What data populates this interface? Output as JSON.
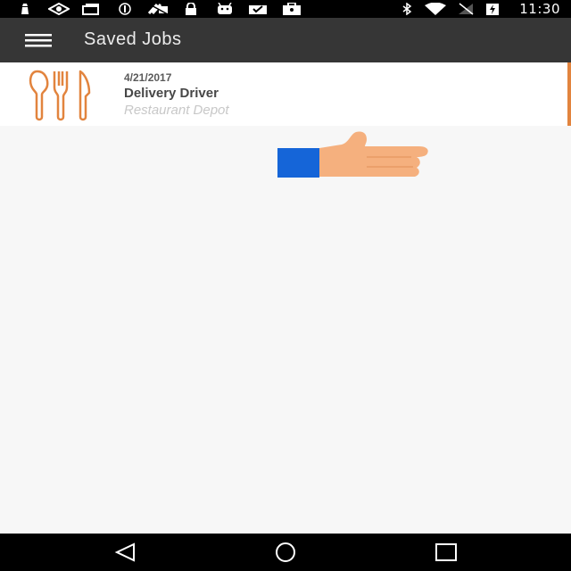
{
  "status_bar": {
    "time": "11:30",
    "left_icons": [
      "lighthouse-icon",
      "eye-icon",
      "cards-icon",
      "disc-icon",
      "no-fax-icon",
      "lock-icon",
      "android-icon",
      "tray-check-icon",
      "briefcase-icon"
    ],
    "right_icons": [
      "bluetooth-icon",
      "wifi-icon",
      "no-signal-icon",
      "battery-charging-icon"
    ]
  },
  "app_bar": {
    "title": "Saved Jobs",
    "menu_icon": "hamburger-menu-icon"
  },
  "saved_jobs": [
    {
      "date": "4/21/2017",
      "title": "Delivery Driver",
      "company": "Restaurant Depot",
      "icon": "utensils-icon",
      "accent_color": "#e2843e"
    }
  ],
  "overlay": {
    "icon": "pointing-hand-icon"
  },
  "nav_bar": {
    "icons": [
      "back-icon",
      "home-icon",
      "recents-icon"
    ]
  },
  "colors": {
    "app_bar": "#363636",
    "background": "#f7f7f7",
    "accent": "#e2843e",
    "status_bar": "#000000"
  }
}
